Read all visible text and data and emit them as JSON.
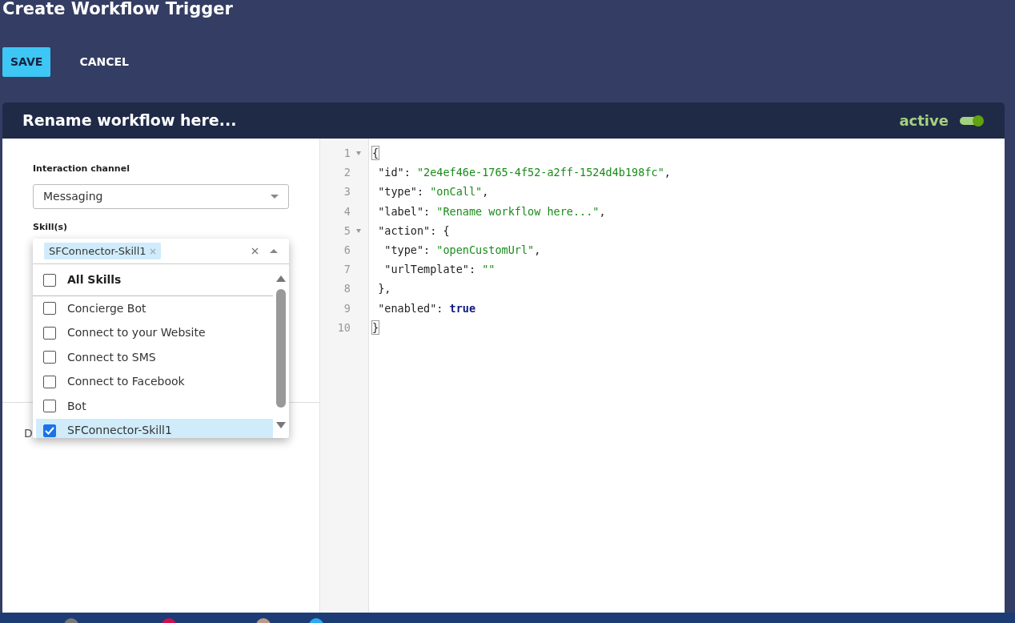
{
  "page": {
    "title": "Create Workflow Trigger"
  },
  "toolbar": {
    "buttons": [
      {
        "label": "SAVE",
        "kind": "primary"
      },
      {
        "label": "CANCEL",
        "kind": "link"
      }
    ]
  },
  "workflow": {
    "name": "Rename workflow here...",
    "status_label": "active",
    "active": true
  },
  "form": {
    "channel": {
      "label": "Interaction channel",
      "value": "Messaging"
    },
    "skills": {
      "label": "Skill(s)",
      "tags": [
        "SFConnector-Skill1"
      ],
      "expanded": true,
      "all_option": {
        "label": "All Skills",
        "checked": false
      },
      "options": [
        {
          "label": "Concierge Bot",
          "checked": false,
          "selected": false
        },
        {
          "label": "Connect to your Website",
          "checked": false,
          "selected": false
        },
        {
          "label": "Connect to SMS",
          "checked": false,
          "selected": false
        },
        {
          "label": "Connect to Facebook",
          "checked": false,
          "selected": false
        },
        {
          "label": "Bot",
          "checked": false,
          "selected": false
        },
        {
          "label": "SFConnector-Skill1",
          "checked": true,
          "selected": true
        }
      ]
    },
    "covered_label": "D"
  },
  "editor": {
    "lines": [
      {
        "number": "1",
        "foldable": true,
        "tokens": [
          {
            "kind": "match",
            "text": "{"
          }
        ]
      },
      {
        "number": "2",
        "foldable": false,
        "tokens": [
          {
            "kind": "key",
            "text": " \"id\""
          },
          {
            "kind": "punct",
            "text": ": "
          },
          {
            "kind": "string",
            "text": "\"2e4ef46e-1765-4f52-a2ff-1524d4b198fc\""
          },
          {
            "kind": "punct",
            "text": ","
          }
        ]
      },
      {
        "number": "3",
        "foldable": false,
        "tokens": [
          {
            "kind": "key",
            "text": " \"type\""
          },
          {
            "kind": "punct",
            "text": ": "
          },
          {
            "kind": "string",
            "text": "\"onCall\""
          },
          {
            "kind": "punct",
            "text": ","
          }
        ]
      },
      {
        "number": "4",
        "foldable": false,
        "tokens": [
          {
            "kind": "key",
            "text": " \"label\""
          },
          {
            "kind": "punct",
            "text": ": "
          },
          {
            "kind": "string",
            "text": "\"Rename workflow here...\""
          },
          {
            "kind": "punct",
            "text": ","
          }
        ]
      },
      {
        "number": "5",
        "foldable": true,
        "tokens": [
          {
            "kind": "key",
            "text": " \"action\""
          },
          {
            "kind": "punct",
            "text": ": {"
          }
        ]
      },
      {
        "number": "6",
        "foldable": false,
        "tokens": [
          {
            "kind": "key",
            "text": "  \"type\""
          },
          {
            "kind": "punct",
            "text": ": "
          },
          {
            "kind": "string",
            "text": "\"openCustomUrl\""
          },
          {
            "kind": "punct",
            "text": ","
          }
        ]
      },
      {
        "number": "7",
        "foldable": false,
        "tokens": [
          {
            "kind": "key",
            "text": "  \"urlTemplate\""
          },
          {
            "kind": "punct",
            "text": ": "
          },
          {
            "kind": "string",
            "text": "\"\""
          }
        ]
      },
      {
        "number": "8",
        "foldable": false,
        "tokens": [
          {
            "kind": "punct",
            "text": " },"
          }
        ]
      },
      {
        "number": "9",
        "foldable": false,
        "tokens": [
          {
            "kind": "key",
            "text": " \"enabled\""
          },
          {
            "kind": "punct",
            "text": ": "
          },
          {
            "kind": "bool",
            "text": "true"
          }
        ]
      },
      {
        "number": "10",
        "foldable": false,
        "tokens": [
          {
            "kind": "match",
            "text": "}"
          }
        ]
      }
    ]
  }
}
